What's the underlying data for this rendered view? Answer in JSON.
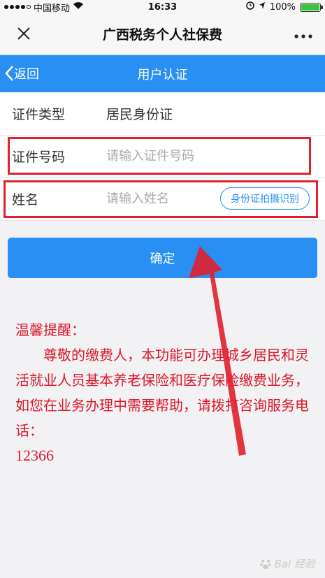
{
  "status_bar": {
    "carrier": "中国移动",
    "time": "16:33",
    "battery": "100%"
  },
  "title_bar": {
    "title": "广西税务个人社保费"
  },
  "nav_bar": {
    "back_label": "返回",
    "title": "用户认证"
  },
  "form": {
    "id_type_label": "证件类型",
    "id_type_value": "居民身份证",
    "id_number_label": "证件号码",
    "id_number_placeholder": "请输入证件号码",
    "id_number_value": "",
    "name_label": "姓名",
    "name_placeholder": "请输入姓名",
    "name_value": "",
    "id_scan_label": "身份证拍摄识别"
  },
  "confirm_label": "确定",
  "notice": {
    "title": "温馨提醒：",
    "body": "尊敬的缴费人，本功能可办理城乡居民和灵活就业人员基本养老保险和医疗保险缴费业务，如您在业务办理中需要帮助，请拨打咨询服务电话：",
    "phone": "12366"
  },
  "watermark": "Bai 经验",
  "colors": {
    "primary_blue": "#2a8ff2",
    "annotation_red": "#e0202e",
    "notice_red": "#d9192a"
  }
}
